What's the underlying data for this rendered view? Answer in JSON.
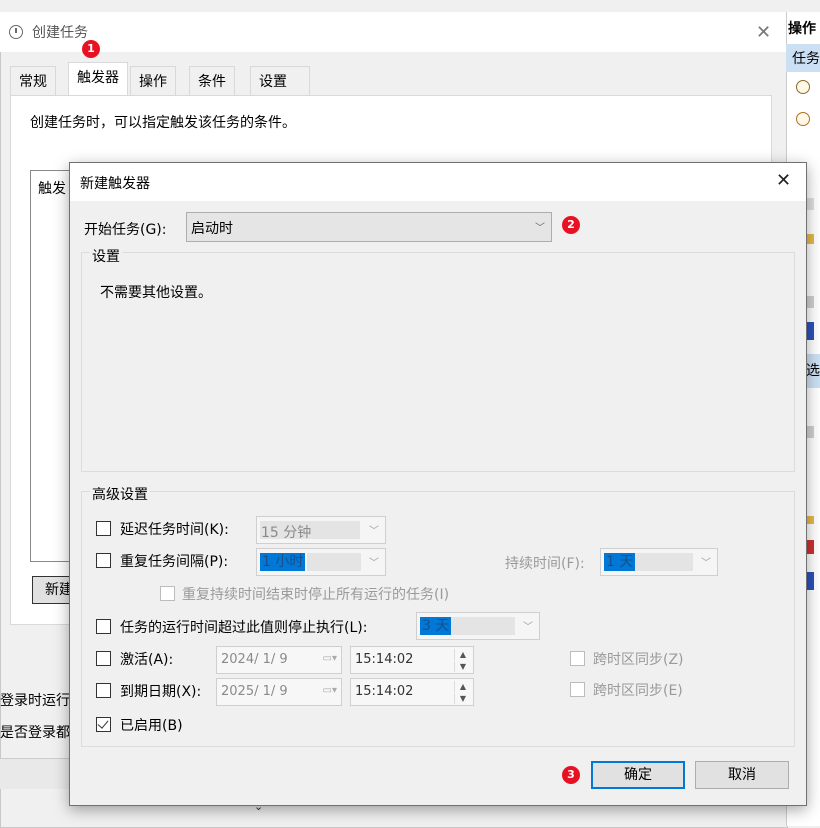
{
  "bg_window": {
    "title": "创建任务",
    "close_glyph": "✕",
    "tabs": [
      "常规",
      "触发器",
      "操作",
      "条件",
      "设置"
    ],
    "description": "创建任务时，可以指定触发该任务的条件。",
    "list_header": "触发",
    "new_button": "新建",
    "row1": "登录时运行",
    "row2": "是否登录都",
    "chevron": "⌄"
  },
  "right_panel": {
    "header": "操作",
    "sub": "任务",
    "selected": "选"
  },
  "badges": {
    "one": "1",
    "two": "2",
    "three": "3"
  },
  "dialog": {
    "title": "新建触发器",
    "close_glyph": "✕",
    "start_label": "开始任务(G):",
    "start_value": "启动时",
    "settings_group": "设置",
    "settings_text": "不需要其他设置。",
    "advanced_group": "高级设置",
    "delay": {
      "label": "延迟任务时间(K):",
      "value": "15 分钟",
      "checked": false
    },
    "repeat": {
      "label": "重复任务间隔(P):",
      "value": "1 小时",
      "checked": false,
      "duration_label": "持续时间(F):",
      "duration_value": "1 天"
    },
    "stop_all": {
      "label": "重复持续时间结束时停止所有运行的任务(I)",
      "checked": false
    },
    "stop_if": {
      "label": "任务的运行时间超过此值则停止执行(L):",
      "value": "3 天",
      "checked": false
    },
    "activate": {
      "label": "激活(A):",
      "date": "2024/ 1/ 9",
      "time": "15:14:02",
      "sync_label": "跨时区同步(Z)",
      "checked": false
    },
    "expire": {
      "label": "到期日期(X):",
      "date": "2025/ 1/ 9",
      "time": "15:14:02",
      "sync_label": "跨时区同步(E)",
      "checked": false
    },
    "enabled": {
      "label": "已启用(B)",
      "checked": true
    },
    "ok_button": "确定",
    "cancel_button": "取消"
  },
  "colors": {
    "accent": "#0078d7",
    "badge": "#e81123",
    "selection": "#cce0f4"
  }
}
